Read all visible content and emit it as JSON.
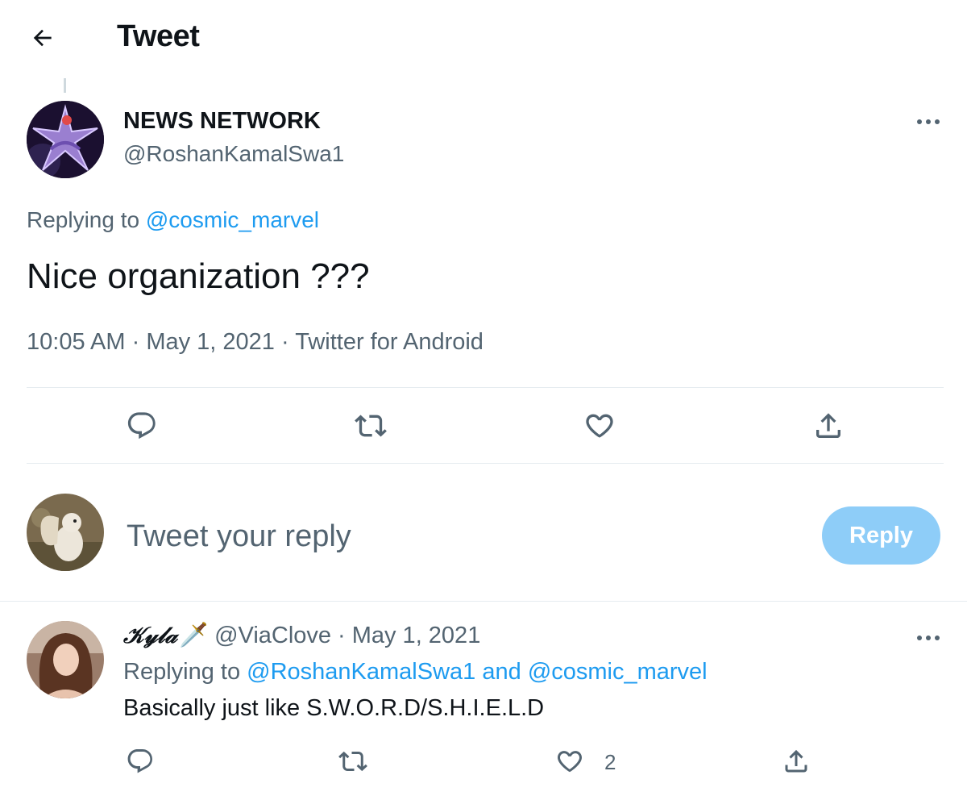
{
  "header": {
    "title": "Tweet"
  },
  "tweet": {
    "author_name": "NEWS NETWORK",
    "author_handle": "@RoshanKamalSwa1",
    "replying_prefix": "Replying to",
    "replying_to": "@cosmic_marvel",
    "text": "Nice organization ???",
    "time": "10:05 AM",
    "date": "May 1, 2021",
    "source": "Twitter for Android",
    "separator": "·"
  },
  "composer": {
    "placeholder": "Tweet your reply",
    "reply_label": "Reply"
  },
  "comment": {
    "author_name": "𝒦𝓎𝓁𝒶",
    "author_emoji": "🗡️",
    "author_handle": "@ViaClove",
    "separator": "·",
    "date": "May 1, 2021",
    "replying_prefix": "Replying to",
    "replying_to_1": "@RoshanKamalSwa1",
    "and": "and",
    "replying_to_2": "@cosmic_marvel",
    "text": "Basically just like S.W.O.R.D/S.H.I.E.L.D",
    "like_count": "2"
  },
  "colors": {
    "accent": "#1d9bf0",
    "reply_button_disabled": "#8ecdf8",
    "secondary_text": "#536471"
  },
  "icons": [
    "back-arrow-icon",
    "more-icon",
    "reply-icon",
    "retweet-icon",
    "like-icon",
    "share-icon",
    "dagger-icon"
  ]
}
